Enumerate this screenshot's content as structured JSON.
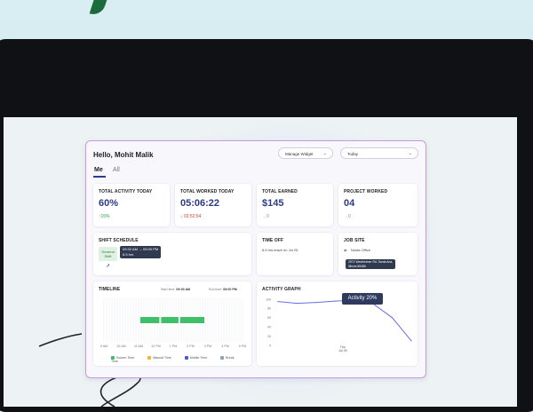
{
  "header": {
    "greeting": "Hello, Mohit Malik",
    "manage_widget": "Manage Widget",
    "period": "Today"
  },
  "tabs": [
    {
      "label": "Me",
      "active": true
    },
    {
      "label": "All",
      "active": false
    }
  ],
  "stats": [
    {
      "title": "TOTAL ACTIVITY TODAY",
      "value": "60%",
      "delta": "↑15%",
      "trend": "up"
    },
    {
      "title": "TOTAL WORKED TODAY",
      "value": "05:06:22",
      "delta": "↓ 03:52:54",
      "trend": "down"
    },
    {
      "title": "TOTAL EARNED",
      "value": "$145",
      "delta": "→0",
      "trend": "neutral"
    },
    {
      "title": "PROJECT WORKED",
      "value": "04",
      "delta": "→0",
      "trend": "neutral"
    }
  ],
  "shift": {
    "title": "SHIFT SCHEDULE",
    "badge_line1": "General",
    "badge_line2": "Shift",
    "tooltip_line1": "09:32 AM → 05:00 PM",
    "tooltip_line2": "8.5 hrs"
  },
  "time_off": {
    "title": "TIME OFF",
    "text": "8.5 hrs leave on Jul 25."
  },
  "job_site": {
    "title": "JOB SITE",
    "location": "Noida Office",
    "address_line1": "2972 Westheimer Rd. Santa Ana,",
    "address_line2": "Illinois 85486"
  },
  "timeline": {
    "title": "TIMELINE",
    "start_label": "Start time:",
    "start_value": "09:00 AM",
    "end_label": "End time:",
    "end_value": "05:00 PM",
    "ticks": [
      "9 AM",
      "10 AM",
      "11 AM",
      "12 PM",
      "1 PM",
      "2 PM",
      "3 PM",
      "4 PM",
      "5 PM"
    ],
    "legend": [
      "Screen Time",
      "Manual Time",
      "Mobile Time",
      "Break Time"
    ],
    "legend_colors": [
      "#3fbf6a",
      "#f2b33d",
      "#4a5bd4",
      "#8fa0b8"
    ]
  },
  "activity": {
    "title": "ACTIVITY GRAPH",
    "tooltip": "Activity 20%",
    "x_label_line1": "Thu",
    "x_label_line2": "Jul 25",
    "line_color": "#6a6ee0"
  },
  "chart_data": {
    "type": "line",
    "title": "ACTIVITY GRAPH",
    "x": [
      "",
      "",
      "",
      "",
      "Thu Jul 25",
      "",
      "",
      ""
    ],
    "series": [
      {
        "values": [
          95,
          91,
          93,
          96,
          98,
          90,
          60,
          10
        ]
      }
    ],
    "yticks": [
      "100",
      "80",
      "60",
      "40",
      "20",
      "0"
    ],
    "ylim": [
      0,
      100
    ],
    "grid": false,
    "annotation": "Activity 20%"
  }
}
